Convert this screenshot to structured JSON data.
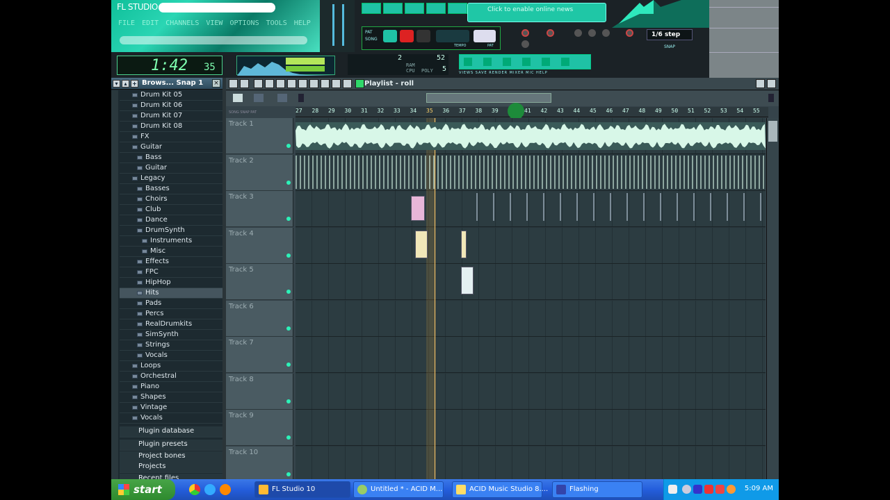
{
  "app": {
    "title": "FL STUDIO"
  },
  "menu": [
    "FILE",
    "EDIT",
    "CHANNELS",
    "VIEW",
    "OPTIONS",
    "TOOLS",
    "HELP"
  ],
  "time": {
    "main": "1:42",
    "sub": "35"
  },
  "cpu": {
    "left": "2",
    "right": "52",
    "poly": "5",
    "ram_label": "RAM",
    "cpu_label": "CPU",
    "poly_label": "POLY"
  },
  "news": {
    "text": "Click to enable online news"
  },
  "snap": {
    "value": "1/6 step",
    "label": "SNAP"
  },
  "transport": {
    "pat_label": "PAT",
    "song_label": "SONG",
    "tempo_label": "TEMPO",
    "pat_num_label": "PAT"
  },
  "toolbar_labels": "VIEWS  SAVE  RENDER  MIXER  MIC  HELP",
  "browser": {
    "title": "Brows... Snap 1",
    "items": [
      {
        "label": "Drum Kit 05",
        "level": 1
      },
      {
        "label": "Drum Kit 06",
        "level": 1
      },
      {
        "label": "Drum Kit 07",
        "level": 1
      },
      {
        "label": "Drum Kit 08",
        "level": 1
      },
      {
        "label": "FX",
        "level": 1
      },
      {
        "label": "Guitar",
        "level": 1
      },
      {
        "label": "Bass",
        "level": 2
      },
      {
        "label": "Guitar",
        "level": 2
      },
      {
        "label": "Legacy",
        "level": 1
      },
      {
        "label": "Basses",
        "level": 2
      },
      {
        "label": "Choirs",
        "level": 2
      },
      {
        "label": "Club",
        "level": 2
      },
      {
        "label": "Dance",
        "level": 2
      },
      {
        "label": "DrumSynth",
        "level": 2
      },
      {
        "label": "Instruments",
        "level": 3
      },
      {
        "label": "Misc",
        "level": 3
      },
      {
        "label": "Effects",
        "level": 2
      },
      {
        "label": "FPC",
        "level": 2
      },
      {
        "label": "HipHop",
        "level": 2
      },
      {
        "label": "Hits",
        "level": 2,
        "selected": true
      },
      {
        "label": "Pads",
        "level": 2
      },
      {
        "label": "Percs",
        "level": 2
      },
      {
        "label": "RealDrumkits",
        "level": 2
      },
      {
        "label": "SimSynth",
        "level": 2
      },
      {
        "label": "Strings",
        "level": 2
      },
      {
        "label": "Vocals",
        "level": 2
      },
      {
        "label": "Loops",
        "level": 1
      },
      {
        "label": "Orchestral",
        "level": 1
      },
      {
        "label": "Piano",
        "level": 1
      },
      {
        "label": "Shapes",
        "level": 1
      },
      {
        "label": "Vintage",
        "level": 1
      },
      {
        "label": "Vocals",
        "level": 1
      }
    ],
    "sections": [
      "Plugin database",
      "Plugin presets",
      "Project bones",
      "Projects",
      "Recent files"
    ]
  },
  "playlist": {
    "title": "Playlist - roll",
    "ruler": [
      "27",
      "28",
      "29",
      "30",
      "31",
      "32",
      "33",
      "34",
      "35",
      "36",
      "37",
      "38",
      "39",
      "40",
      "41",
      "42",
      "43",
      "44",
      "45",
      "46",
      "47",
      "48",
      "49",
      "50",
      "51",
      "52",
      "53",
      "54",
      "55"
    ],
    "tracks": [
      "Track 1",
      "Track 2",
      "Track 3",
      "Track 4",
      "Track 5",
      "Track 6",
      "Track 7",
      "Track 8",
      "Track 9",
      "Track 10"
    ],
    "snap_labels": "SONG  SNAP  PAT"
  },
  "taskbar": {
    "start": "start",
    "tasks": [
      "FL Studio 10",
      "Untitled * - ACID M...",
      "ACID Music Studio 8....",
      "Flashing"
    ],
    "clock": "5:09 AM"
  },
  "colors": {
    "accent": "#1fc2a5",
    "track_led": "#2cf2b8",
    "playhead": "#f5c36a",
    "taskbar": "#245edc"
  }
}
